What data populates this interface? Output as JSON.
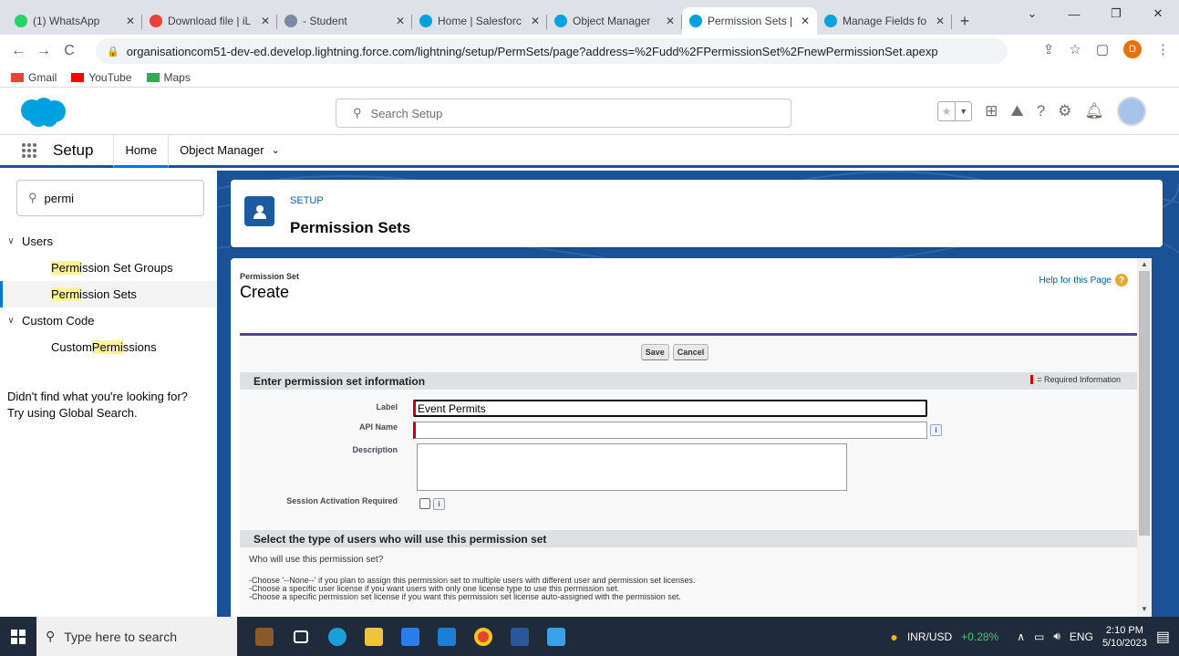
{
  "browser": {
    "tabs": [
      {
        "title": "(1) WhatsApp",
        "color": "#25d366",
        "active": false
      },
      {
        "title": "Download file | iL",
        "color": "#e8403a",
        "active": false
      },
      {
        "title": "- Student",
        "color": "#7a8aa6",
        "active": false
      },
      {
        "title": "Home | Salesforc",
        "color": "#00a1e0",
        "active": false
      },
      {
        "title": "Object Manager",
        "color": "#00a1e0",
        "active": false
      },
      {
        "title": "Permission Sets |",
        "color": "#00a1e0",
        "active": true
      },
      {
        "title": "Manage Fields fo",
        "color": "#00a1e0",
        "active": false
      }
    ],
    "url": "organisationcom51-dev-ed.develop.lightning.force.com/lightning/setup/PermSets/page?address=%2Fudd%2FPermissionSet%2FnewPermissionSet.apexp",
    "profile_initial": "D",
    "bookmarks": [
      {
        "label": "Gmail",
        "color": "#ea4335"
      },
      {
        "label": "YouTube",
        "color": "#ff0000"
      },
      {
        "label": "Maps",
        "color": "#34a853"
      }
    ]
  },
  "sf": {
    "search_placeholder": "Search Setup",
    "app_name": "Setup",
    "nav": {
      "home": "Home",
      "object_manager": "Object Manager"
    },
    "quick_find_value": "permi",
    "tree": {
      "users_group": "Users",
      "psg": {
        "hl": "Permi",
        "rest": "ssion Set Groups"
      },
      "ps": {
        "hl": "Permi",
        "rest": "ssion Sets"
      },
      "custom_code_group": "Custom Code",
      "cp": {
        "pre": "Custom ",
        "hl": "Permi",
        "rest": "ssions"
      }
    },
    "not_found_line1": "Didn't find what you're looking for?",
    "not_found_line2": "Try using Global Search.",
    "page_header": {
      "setup": "SETUP",
      "title": "Permission Sets"
    }
  },
  "form": {
    "subtitle": "Permission Set",
    "title": "Create",
    "help_link": "Help for this Page",
    "save": "Save",
    "cancel": "Cancel",
    "section1": "Enter permission set information",
    "required_legend": "= Required Information",
    "label_label": "Label",
    "label_value": "Event Permits",
    "api_name_label": "API Name",
    "api_name_value": "",
    "description_label": "Description",
    "session_label": "Session Activation Required",
    "section2": "Select the type of users who will use this permission set",
    "who_question": "Who will use this permission set?",
    "line1": "-Choose '--None--' if you plan to assign this permission set to multiple users with different user and permission set licenses.",
    "line2": "-Choose a specific user license if you want users with only one license type to use this permission set.",
    "line3": "-Choose a specific permission set license if you want this permission set license auto-assigned with the permission set."
  },
  "taskbar": {
    "search_placeholder": "Type here to search",
    "stock_label": "INR/USD",
    "stock_change": "+0.28%",
    "lang": "ENG",
    "time": "2:10 PM",
    "date": "5/10/2023"
  }
}
